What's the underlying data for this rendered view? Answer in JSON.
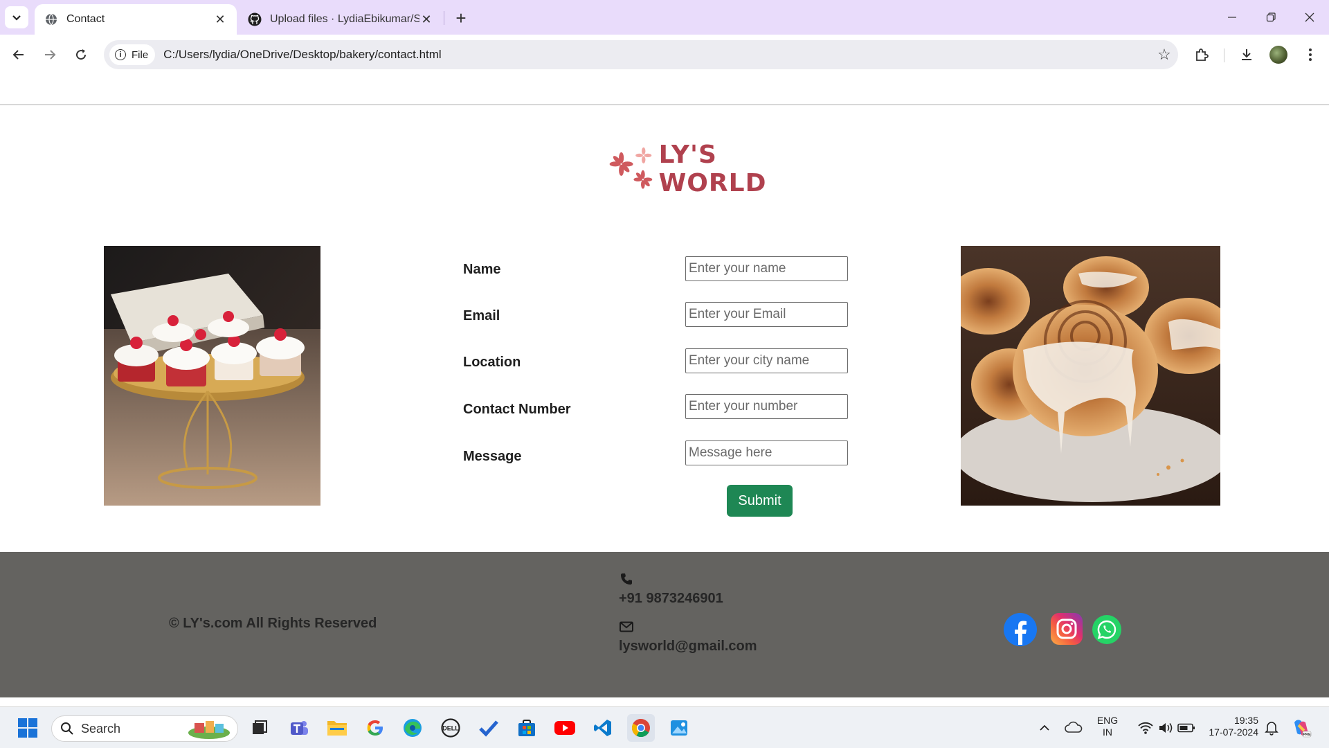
{
  "browser": {
    "tabs": [
      {
        "title": "Contact",
        "active": true
      },
      {
        "title": "Upload files · LydiaEbikumar/Sta",
        "active": false
      }
    ],
    "address": {
      "chip_label": "File",
      "url": "C:/Users/lydia/OneDrive/Desktop/bakery/contact.html"
    }
  },
  "page": {
    "logo_text": "LY'S WORLD",
    "form": {
      "fields": [
        {
          "label": "Name",
          "placeholder": "Enter your name"
        },
        {
          "label": "Email",
          "placeholder": "Enter your Email"
        },
        {
          "label": "Location",
          "placeholder": "Enter your city name"
        },
        {
          "label": "Contact Number",
          "placeholder": "Enter your number"
        },
        {
          "label": "Message",
          "placeholder": "Message here"
        }
      ],
      "submit_label": "Submit"
    },
    "footer": {
      "copyright": "© LY's.com All Rights Reserved",
      "phone": "+91 9873246901",
      "email": "lysworld@gmail.com",
      "social": [
        "facebook",
        "instagram",
        "whatsapp"
      ]
    }
  },
  "taskbar": {
    "search_label": "Search",
    "language": {
      "line1": "ENG",
      "line2": "IN"
    },
    "clock": {
      "time": "19:35",
      "date": "17-07-2024"
    }
  },
  "colors": {
    "tabbar": "#e9dcfb",
    "logo": "#b0414e",
    "submit": "#1e8754",
    "footer": "#646360"
  }
}
